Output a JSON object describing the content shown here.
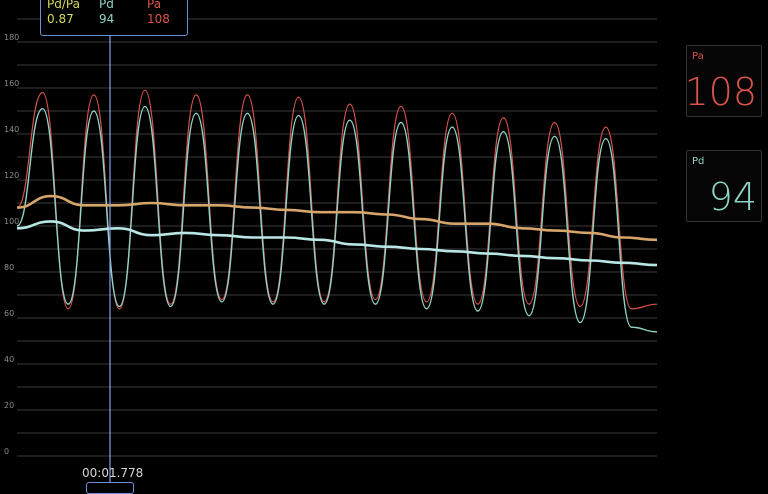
{
  "colors": {
    "pa": "#d9534a",
    "pd": "#8fd4c8",
    "ratio": "#d6d85a",
    "pa_mean": "#d6a56a",
    "pd_mean": "#b8e6e4",
    "cursor": "#7fa4ea"
  },
  "cursor_readout": {
    "ratio_label": "Pd/Pa",
    "ratio_value": "0.87",
    "pd_label": "Pd",
    "pd_value": "94",
    "pa_label": "Pa",
    "pa_value": "108"
  },
  "time_label": "00:01.778",
  "panels": {
    "pa": {
      "label": "Pa",
      "value": "108"
    },
    "pd": {
      "label": "Pd",
      "value": "94"
    }
  },
  "chart_data": {
    "type": "line",
    "y_ticks": [
      "0",
      "20",
      "40",
      "60",
      "80",
      "100",
      "120",
      "140",
      "160",
      "180"
    ],
    "ylim": [
      0,
      200
    ],
    "grid": true,
    "series": [
      {
        "name": "Pa",
        "values": [
          108,
          158,
          64,
          157,
          64,
          159,
          66,
          157,
          68,
          157,
          67,
          156,
          67,
          153,
          68,
          152,
          67,
          149,
          66,
          147,
          66,
          145,
          65,
          143,
          64,
          66
        ]
      },
      {
        "name": "Pd",
        "values": [
          100,
          151,
          66,
          150,
          65,
          152,
          65,
          149,
          67,
          149,
          66,
          148,
          66,
          146,
          66,
          145,
          64,
          143,
          63,
          141,
          61,
          139,
          58,
          138,
          56,
          54
        ]
      },
      {
        "name": "Pa mean",
        "values": [
          108,
          113,
          109,
          109,
          110,
          109,
          109,
          108,
          107,
          106,
          106,
          105,
          103,
          101,
          101,
          99,
          98,
          97,
          95,
          94
        ]
      },
      {
        "name": "Pd mean",
        "values": [
          99,
          102,
          98,
          99,
          96,
          97,
          96,
          95,
          95,
          94,
          92,
          91,
          90,
          89,
          88,
          87,
          86,
          85,
          84,
          83
        ]
      }
    ]
  }
}
